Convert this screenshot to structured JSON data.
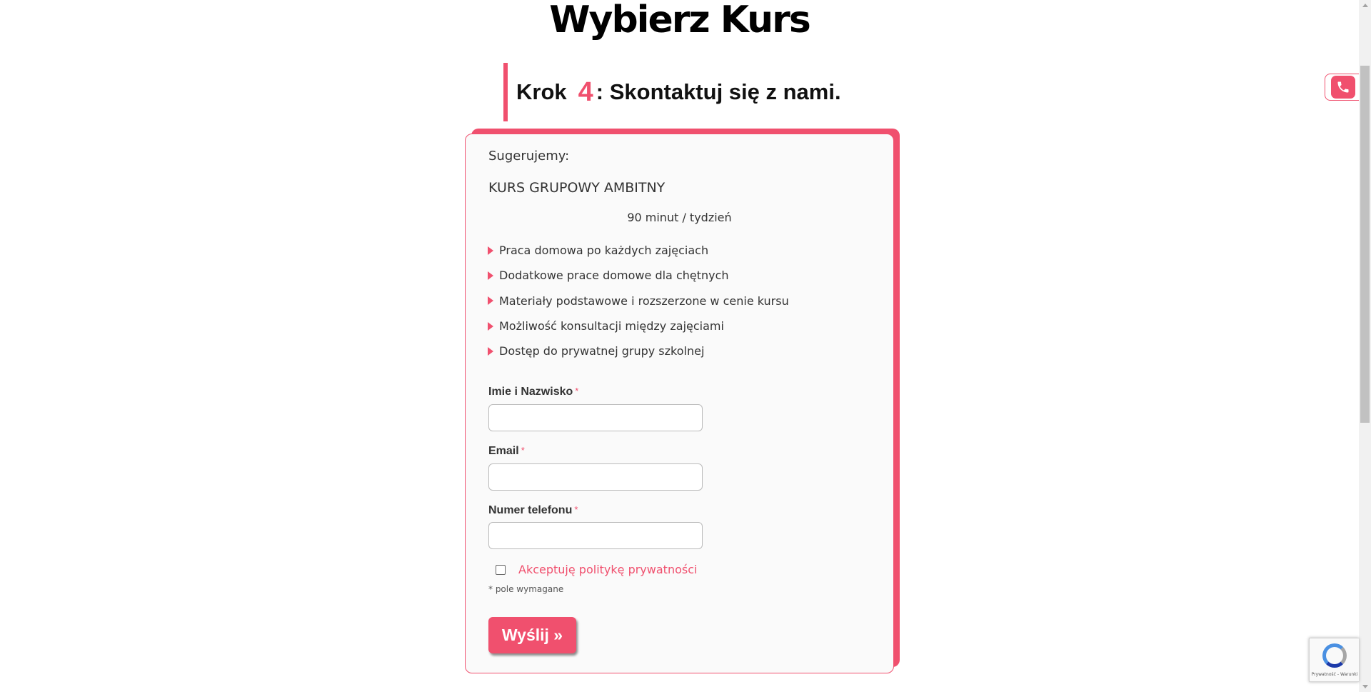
{
  "page": {
    "title": "Wybierz Kurs",
    "step_prefix": "Krok",
    "step_number": "4",
    "step_text": ": Skontaktuj się z nami."
  },
  "offer": {
    "suggest_label": "Sugerujemy:",
    "course_name": "KURS GRUPOWY AMBITNY",
    "course_time": "90 minut / tydzień",
    "features": [
      "Praca domowa po każdych zajęciach",
      "Dodatkowe prace domowe dla chętnych",
      "Materiały podstawowe i rozszerzone w cenie kursu",
      "Możliwość konsultacji między zajęciami",
      "Dostęp do prywatnej grupy szkolnej"
    ]
  },
  "form": {
    "name_label": "Imie i Nazwisko",
    "email_label": "Email",
    "phone_label": "Numer telefonu",
    "required_mark": "*",
    "name_value": "",
    "email_value": "",
    "phone_value": "",
    "consent_text": "Akceptuję politykę prywatności",
    "consent_checked": false,
    "required_note": "* pole wymagane",
    "submit_label": "Wyślij »"
  },
  "widgets": {
    "phone_icon": "phone-icon",
    "recaptcha_text": "Prywatność - Warunki"
  },
  "colors": {
    "accent": "#f0506e",
    "card_bg": "#fafafa",
    "text": "#333333"
  }
}
